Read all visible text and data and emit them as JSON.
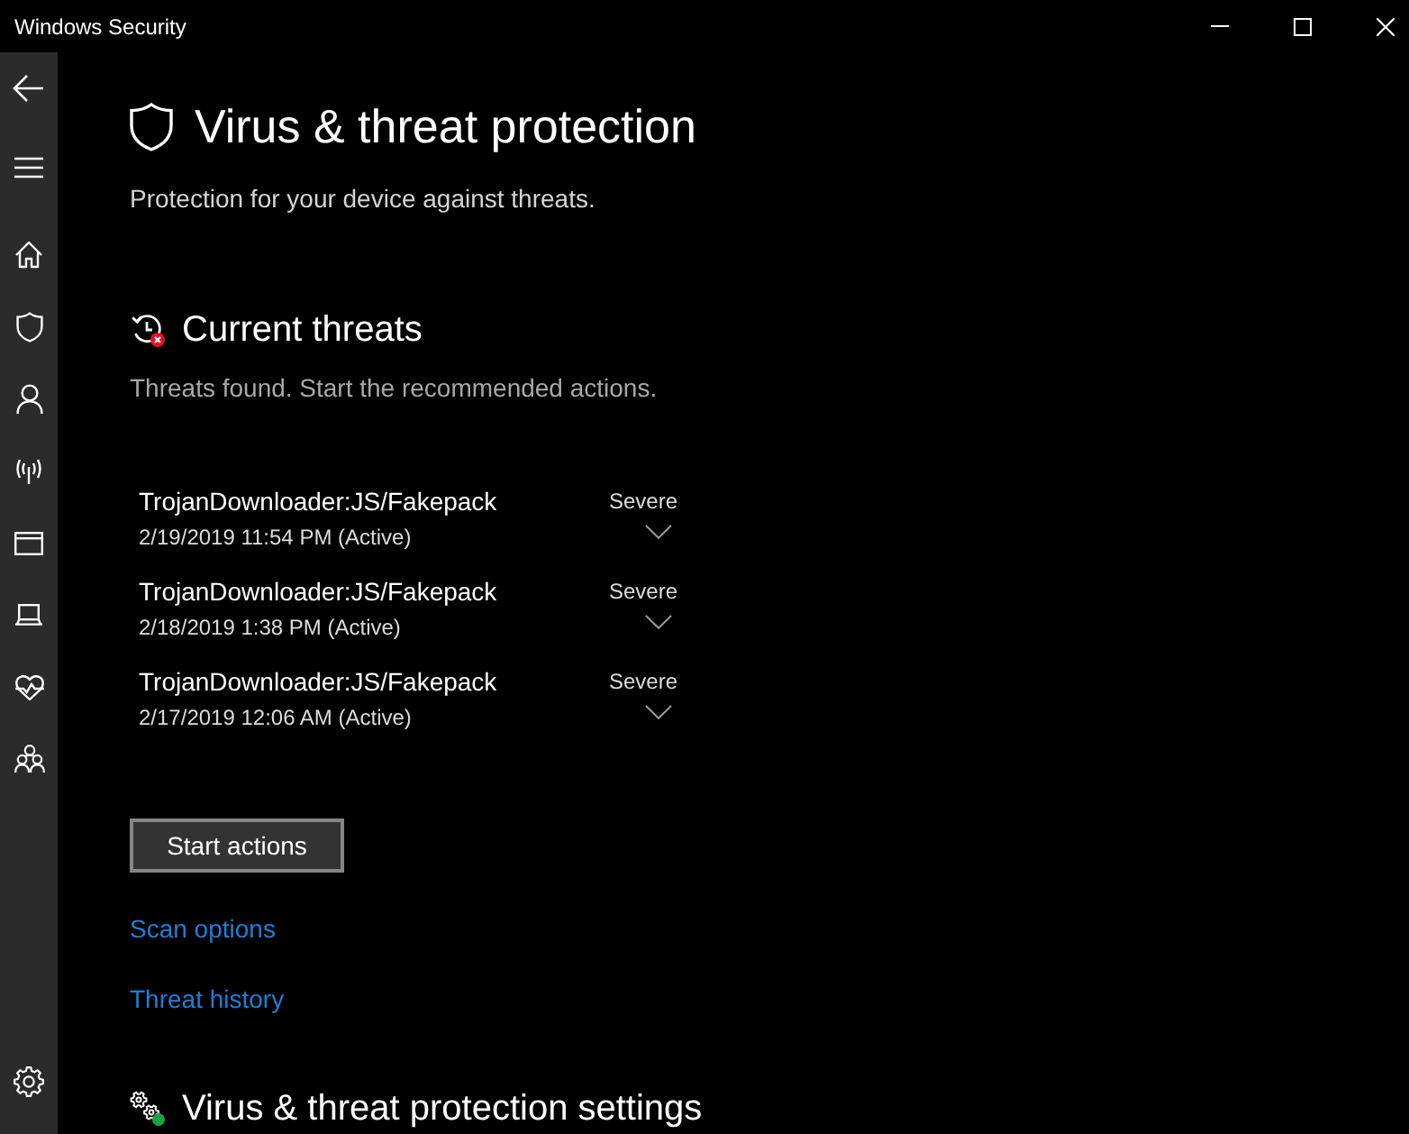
{
  "window": {
    "title": "Windows Security"
  },
  "page": {
    "title": "Virus & threat protection",
    "subtitle": "Protection for your device against threats."
  },
  "current_threats": {
    "heading": "Current threats",
    "description": "Threats found. Start the recommended actions.",
    "threats": [
      {
        "name": "TrojanDownloader:JS/Fakepack",
        "detected": "2/19/2019 11:54 PM (Active)",
        "severity": "Severe",
        "expanded": false
      },
      {
        "name": "TrojanDownloader:JS/Fakepack",
        "detected": "2/18/2019 1:38 PM (Active)",
        "severity": "Severe",
        "expanded": false
      },
      {
        "name": "TrojanDownloader:JS/Fakepack",
        "detected": "2/17/2019 12:06 AM (Active)",
        "severity": "Severe",
        "expanded": false
      }
    ],
    "button": "Start actions",
    "links": [
      "Scan options",
      "Threat history"
    ]
  },
  "settings": {
    "heading": "Virus & threat protection settings"
  }
}
